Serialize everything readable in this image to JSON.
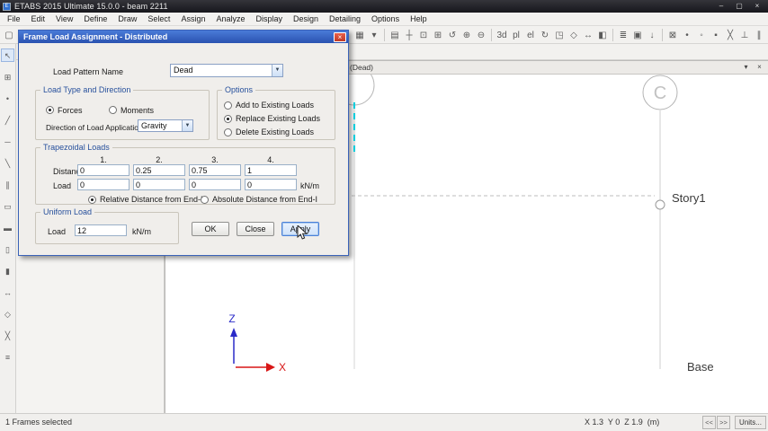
{
  "colors": {
    "dialog_title_blue": "#2a52b0",
    "selection_cyan": "#00d8e8",
    "axis_x_red": "#d81616",
    "axis_z_blue": "#2a2ac8",
    "group_label_blue": "#27509c"
  },
  "titlebar": {
    "title": "ETABS 2015 Ultimate 15.0.0 - beam 2211",
    "minimize_glyph": "–",
    "maximize_glyph": "▢",
    "close_glyph": "×"
  },
  "menubar": {
    "items": [
      "File",
      "Edit",
      "View",
      "Define",
      "Draw",
      "Select",
      "Assign",
      "Analyze",
      "Display",
      "Design",
      "Detailing",
      "Options",
      "Help"
    ]
  },
  "toolbars": {
    "top_left": [
      {
        "name": "new-model",
        "glyph": "▢"
      },
      {
        "name": "open-model",
        "glyph": "▧"
      },
      {
        "name": "save-model",
        "glyph": "▦"
      },
      {
        "name": "print",
        "glyph": "▤"
      },
      {
        "name": "undo",
        "glyph": "↺"
      },
      {
        "name": "redo",
        "glyph": "↻"
      }
    ],
    "top_right": [
      {
        "name": "display-options",
        "glyph": "▦"
      },
      {
        "name": "display-options-dropdown",
        "glyph": "▾"
      },
      {
        "sep": true
      },
      {
        "name": "print-graphics",
        "glyph": "▤"
      },
      {
        "name": "pan",
        "glyph": "┼"
      },
      {
        "name": "rubber-band-zoom",
        "glyph": "⊡"
      },
      {
        "name": "restore-full-view",
        "glyph": "⊞"
      },
      {
        "name": "previous-zoom",
        "glyph": "↺"
      },
      {
        "name": "zoom-in",
        "glyph": "⊕"
      },
      {
        "name": "zoom-out",
        "glyph": "⊖"
      },
      {
        "sep": true
      },
      {
        "name": "3d-view",
        "glyph": "3d"
      },
      {
        "name": "plan-view",
        "glyph": "pl"
      },
      {
        "name": "elevation-view",
        "glyph": "el"
      },
      {
        "name": "rotate-3d-view",
        "glyph": "↻"
      },
      {
        "name": "object-shrink-toggle",
        "glyph": "◳"
      },
      {
        "name": "perspective-toggle",
        "glyph": "◇"
      },
      {
        "name": "move-view",
        "glyph": "↔"
      },
      {
        "name": "view-limits",
        "glyph": "◧"
      },
      {
        "sep": true
      },
      {
        "name": "show-selection",
        "glyph": "≣"
      },
      {
        "name": "assign-display",
        "glyph": "▣"
      },
      {
        "name": "show-loads",
        "glyph": "↓"
      },
      {
        "sep": true
      },
      {
        "name": "snap-grid",
        "glyph": "⊠"
      },
      {
        "name": "snap-joints",
        "glyph": "•"
      },
      {
        "name": "snap-midpoints",
        "glyph": "◦"
      },
      {
        "name": "snap-ends",
        "glyph": "▪"
      },
      {
        "name": "snap-intersections",
        "glyph": "╳"
      },
      {
        "name": "snap-perpendicular",
        "glyph": "⊥"
      },
      {
        "name": "snap-parallel",
        "glyph": "∥"
      }
    ],
    "left": [
      {
        "name": "select-pointer",
        "glyph": "↖"
      },
      {
        "name": "reshape-object",
        "glyph": "⊞"
      },
      {
        "name": "draw-joint",
        "glyph": "•"
      },
      {
        "name": "draw-frame",
        "glyph": "╱"
      },
      {
        "name": "quick-draw-beam",
        "glyph": "─"
      },
      {
        "name": "quick-draw-brace",
        "glyph": "╲"
      },
      {
        "name": "quick-draw-secondary-beams",
        "glyph": "∥"
      },
      {
        "name": "draw-floor",
        "glyph": "▭"
      },
      {
        "name": "quick-draw-floor",
        "glyph": "▬"
      },
      {
        "name": "draw-wall",
        "glyph": "▯"
      },
      {
        "name": "quick-draw-wall",
        "glyph": "▮"
      },
      {
        "name": "draw-link",
        "glyph": "↔"
      },
      {
        "name": "draw-dimension",
        "glyph": "◇"
      },
      {
        "name": "draw-grid",
        "glyph": "╳"
      },
      {
        "name": "snap-options",
        "glyph": "≡"
      }
    ]
  },
  "dialog": {
    "title": "Frame Load Assignment - Distributed",
    "close_glyph": "×",
    "load_pattern": {
      "label": "Load Pattern Name",
      "value": "Dead"
    },
    "load_type": {
      "group_label": "Load Type and Direction",
      "forces": "Forces",
      "moments": "Moments",
      "direction_label": "Direction of Load Application",
      "direction_value": "Gravity"
    },
    "options": {
      "group_label": "Options",
      "add": "Add to Existing Loads",
      "replace": "Replace Existing Loads",
      "delete": "Delete Existing Loads"
    },
    "trapezoidal": {
      "group_label": "Trapezoidal Loads",
      "columns": [
        "1.",
        "2.",
        "3.",
        "4."
      ],
      "distance_label": "Distance",
      "distances": [
        "0",
        "0.25",
        "0.75",
        "1"
      ],
      "load_label": "Load",
      "loads": [
        "0",
        "0",
        "0",
        "0"
      ],
      "unit": "kN/m",
      "relative": "Relative Distance from End-I",
      "absolute": "Absolute Distance from End-I"
    },
    "uniform": {
      "group_label": "Uniform Load",
      "load_label": "Load",
      "value": "12",
      "unit": "kN/m"
    },
    "buttons": {
      "ok": "OK",
      "close": "Close",
      "apply": "Apply"
    }
  },
  "view": {
    "tab_label": "(Dead)",
    "tab_menu_glyph": "▾",
    "tab_close_glyph": "×",
    "grid_bubble": "C",
    "story_label": "Story1",
    "base_label": "Base",
    "axis_z": "Z",
    "axis_x": "X"
  },
  "statusbar": {
    "message": "1 Frames selected",
    "coordinates": "X 1.3  Y 0  Z 1.9  (m)",
    "nav_back": "<<",
    "nav_forward": ">>",
    "units": "Units..."
  }
}
